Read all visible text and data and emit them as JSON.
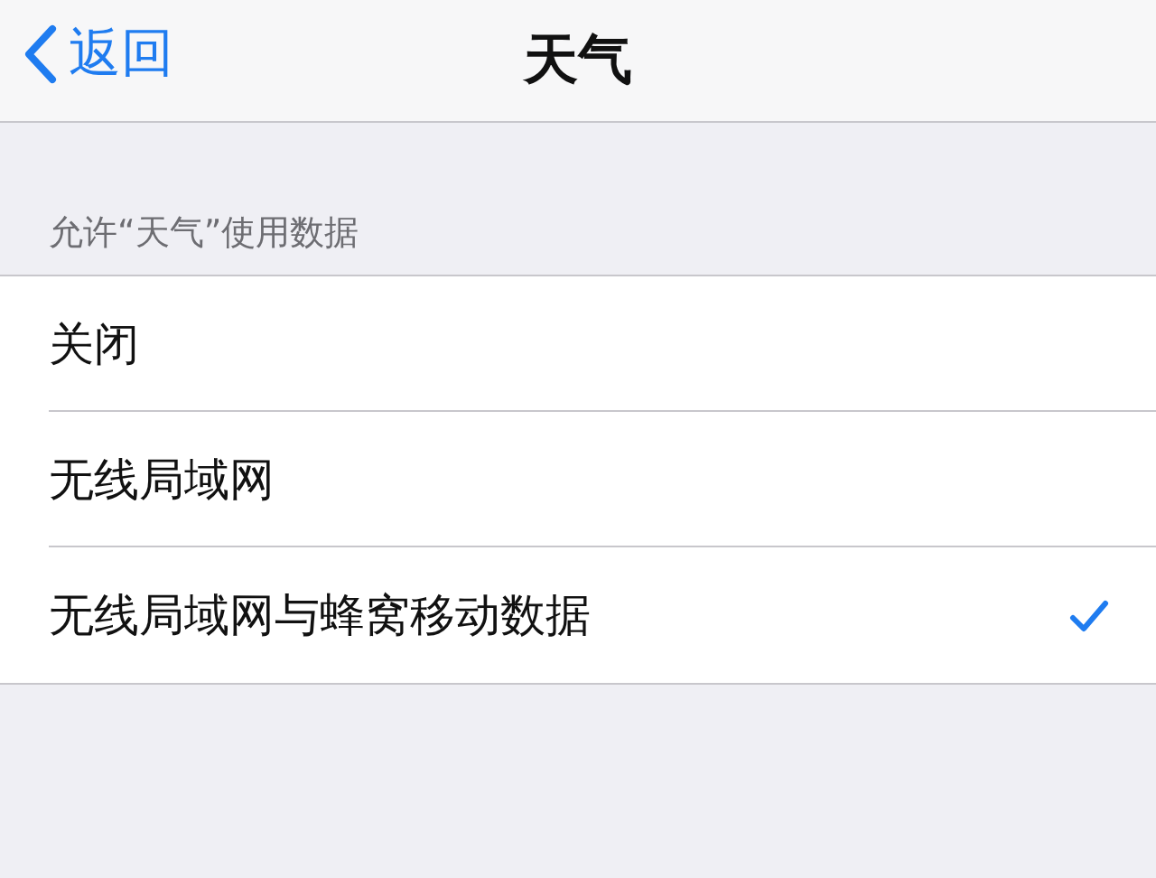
{
  "nav": {
    "back_label": "返回",
    "title": "天气"
  },
  "section": {
    "header": "允许“天气”使用数据",
    "options": [
      {
        "label": "关闭",
        "selected": false
      },
      {
        "label": "无线局域网",
        "selected": false
      },
      {
        "label": "无线局域网与蜂窝移动数据",
        "selected": true
      }
    ]
  }
}
